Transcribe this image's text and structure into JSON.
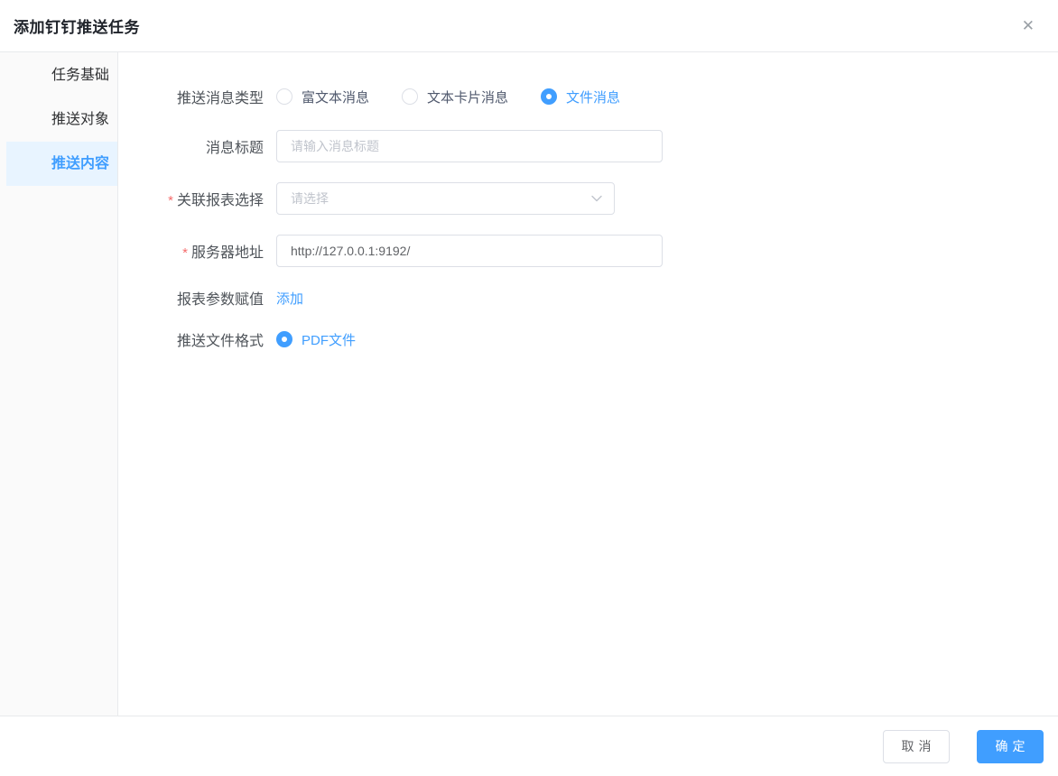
{
  "header": {
    "title": "添加钉钉推送任务",
    "close_glyph": "✕"
  },
  "sidebar": {
    "active_index": 2,
    "items": [
      {
        "label": "任务基础"
      },
      {
        "label": "推送对象"
      },
      {
        "label": "推送内容"
      }
    ]
  },
  "form": {
    "message_type": {
      "label": "推送消息类型",
      "options": [
        {
          "label": "富文本消息",
          "selected": false
        },
        {
          "label": "文本卡片消息",
          "selected": false
        },
        {
          "label": "文件消息",
          "selected": true
        }
      ]
    },
    "message_title": {
      "label": "消息标题",
      "placeholder": "请输入消息标题",
      "value": ""
    },
    "report_select": {
      "label": "关联报表选择",
      "required_mark": "*",
      "placeholder": "请选择"
    },
    "server_address": {
      "label": "服务器地址",
      "required_mark": "*",
      "value": "http://127.0.0.1:9192/"
    },
    "report_params": {
      "label": "报表参数赋值",
      "add_link": "添加"
    },
    "file_format": {
      "label": "推送文件格式",
      "options": [
        {
          "label": "PDF文件",
          "selected": true
        }
      ]
    }
  },
  "footer": {
    "cancel_label": "取消",
    "confirm_label": "确定"
  },
  "colors": {
    "accent": "#409eff",
    "required": "#f56c6c",
    "sidebar_active_bg": "#e8f4ff",
    "border": "#dcdfe6",
    "placeholder": "#c0c4cc"
  }
}
